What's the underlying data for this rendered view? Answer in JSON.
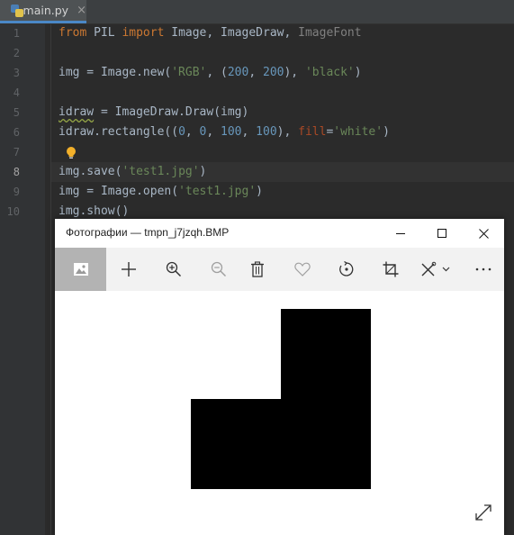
{
  "editor": {
    "tab": {
      "label": "main.py",
      "close": "×"
    },
    "lines": {
      "n1": "1",
      "n2": "2",
      "n3": "3",
      "n4": "4",
      "n5": "5",
      "n6": "6",
      "n7": "7",
      "n8": "8",
      "n9": "9",
      "n10": "10"
    },
    "code": {
      "l1": {
        "from": "from",
        "mod": " PIL ",
        "import": "import",
        "names": " Image, ImageDraw, ",
        "unused": "ImageFont"
      },
      "l3": {
        "a": "img = Image.new(",
        "s1": "'RGB'",
        "b": ", (",
        "n1": "200",
        "c": ", ",
        "n2": "200",
        "d": "), ",
        "s2": "'black'",
        "e": ")"
      },
      "l5": {
        "var": "idraw",
        "rest": " = ImageDraw.Draw(img)"
      },
      "l6": {
        "a": "idraw.rectangle((",
        "n1": "0",
        "c1": ", ",
        "n2": "0",
        "c2": ", ",
        "n3": "100",
        "c3": ", ",
        "n4": "100",
        "b": "), ",
        "p": "fill",
        "eq": "=",
        "s": "'white'",
        "e": ")"
      },
      "l8": {
        "a": "img.save(",
        "s": "'test1.jpg'",
        "e": ")"
      },
      "l9": {
        "a": "img = Image.open(",
        "s": "'test1.jpg'",
        "e": ")"
      },
      "l10": {
        "a": "img.show()"
      }
    },
    "colors": {
      "background": "#2b2b2b",
      "keyword": "#cc7832",
      "string": "#6a8759",
      "number": "#6897bb",
      "text": "#a9b7c6"
    }
  },
  "photos_window": {
    "title": "Фотографии — tmpn_j7jzqh.BMP",
    "window_buttons": [
      "minimize-icon",
      "maximize-icon",
      "close-icon"
    ],
    "toolbar": [
      "image-icon",
      "plus-icon",
      "zoom-in-icon",
      "zoom-out-icon",
      "delete-icon",
      "heart-icon",
      "rotate-icon",
      "crop-icon",
      "edit-icon",
      "more-icon"
    ],
    "image": {
      "background": "#ffffff",
      "fill": "#000000"
    }
  }
}
